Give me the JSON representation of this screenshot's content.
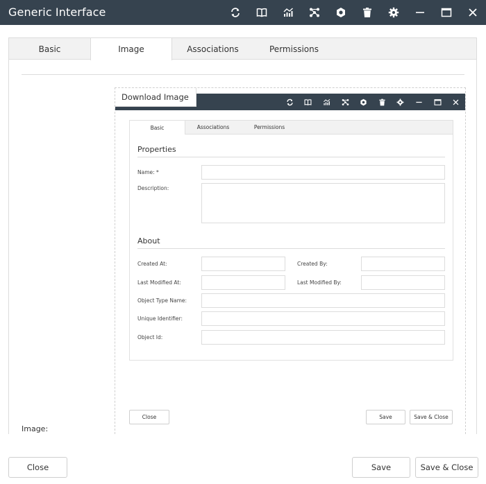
{
  "window": {
    "title": "Generic Interface",
    "toolbar_icons": [
      "refresh-icon",
      "book-icon",
      "chart-icon",
      "network-icon",
      "cog-icon",
      "trash-icon",
      "gear-icon",
      "minimize-icon",
      "maximize-icon",
      "close-icon"
    ]
  },
  "outer_tabs": [
    {
      "label": "Basic",
      "active": false
    },
    {
      "label": "Image",
      "active": true
    },
    {
      "label": "Associations",
      "active": false
    },
    {
      "label": "Permissions",
      "active": false
    }
  ],
  "image_field_label": "Image:",
  "embedded": {
    "title": "Download Image",
    "tabs": [
      {
        "label": "Basic",
        "active": true
      },
      {
        "label": "Associations",
        "active": false
      },
      {
        "label": "Permissions",
        "active": false
      }
    ],
    "properties": {
      "heading": "Properties",
      "name_label": "Name: *",
      "name_value": "",
      "description_label": "Description:",
      "description_value": ""
    },
    "about": {
      "heading": "About",
      "created_at_label": "Created At:",
      "created_by_label": "Created By:",
      "last_modified_at_label": "Last Modified At:",
      "last_modified_by_label": "Last Modified By:",
      "object_type_name_label": "Object Type Name:",
      "unique_identifier_label": "Unique Identifier:",
      "object_id_label": "Object Id:"
    },
    "buttons": {
      "close": "Close",
      "save": "Save",
      "save_close": "Save & Close"
    }
  },
  "footer": {
    "close": "Close",
    "save": "Save",
    "save_close": "Save & Close"
  },
  "colors": {
    "titlebar": "#36434f",
    "tabbar": "#f2f2f2",
    "border": "#dcdcdc"
  }
}
